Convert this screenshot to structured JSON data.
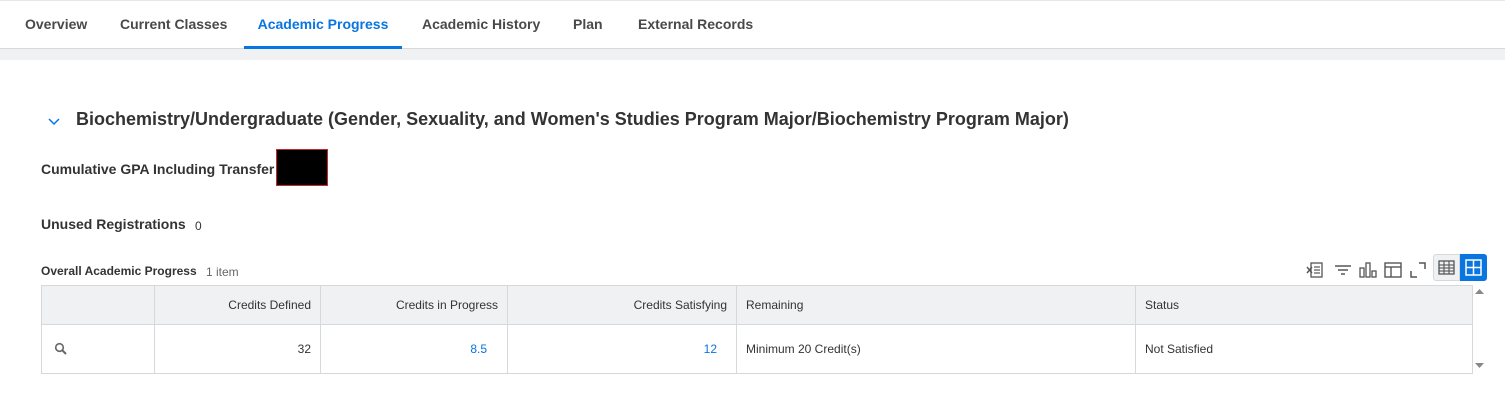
{
  "tabs": [
    {
      "label": "Overview"
    },
    {
      "label": "Current Classes"
    },
    {
      "label": "Academic Progress"
    },
    {
      "label": "Academic History"
    },
    {
      "label": "Plan"
    },
    {
      "label": "External Records"
    }
  ],
  "active_tab": "Academic Progress",
  "section": {
    "title": "Biochemistry/Undergraduate (Gender, Sexuality, and Women's Studies Program Major/Biochemistry Program Major)"
  },
  "fields": {
    "gpa_label": "Cumulative GPA Including Transfer",
    "unused_label": "Unused Registrations",
    "unused_value": "0"
  },
  "grid": {
    "title": "Overall Academic Progress",
    "count": "1 item",
    "columns": [
      "",
      "Credits Defined",
      "Credits in Progress",
      "Credits Satisfying",
      "Remaining",
      "Status"
    ],
    "rows": [
      {
        "credits_defined": "32",
        "credits_in_progress": "8.5",
        "credits_satisfying": "12",
        "remaining": "Minimum 20 Credit(s)",
        "status": "Not Satisfied"
      }
    ]
  },
  "colors": {
    "accent": "#0875e1",
    "header_bg": "#f0f1f2",
    "border": "#d7d8da"
  },
  "icons": [
    "chevron-down-icon",
    "export-excel-icon",
    "filter-icon",
    "chart-icon",
    "columns-icon",
    "fullscreen-icon",
    "table-view-icon",
    "grid-view-icon",
    "search-icon",
    "scroll-up-icon",
    "scroll-down-icon"
  ]
}
